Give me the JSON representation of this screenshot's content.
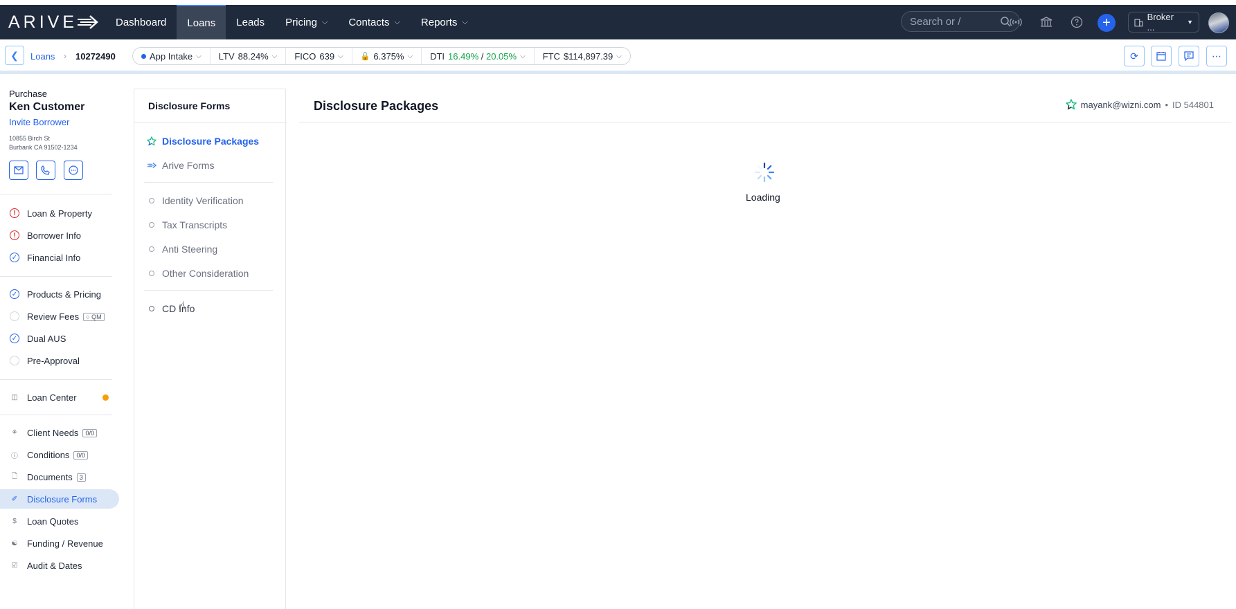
{
  "app": {
    "logo": "ARIVE"
  },
  "navbar": {
    "items": [
      {
        "label": "Dashboard",
        "has_menu": false
      },
      {
        "label": "Loans",
        "has_menu": false,
        "active": true
      },
      {
        "label": "Leads",
        "has_menu": false
      },
      {
        "label": "Pricing",
        "has_menu": true
      },
      {
        "label": "Contacts",
        "has_menu": true
      },
      {
        "label": "Reports",
        "has_menu": true
      }
    ],
    "search_placeholder": "Search or /",
    "broker_label": "Broker ...",
    "colors": {
      "background": "#1f2a3c",
      "accent": "#2563eb"
    }
  },
  "subbar": {
    "breadcrumb": {
      "loans": "Loans",
      "loan_id": "10272490"
    },
    "status": "App Intake",
    "ltv_label": "LTV",
    "ltv_value": "88.24%",
    "fico_label": "FICO",
    "fico_value": "639",
    "rate": "6.375%",
    "dti_label": "DTI",
    "dti_front": "16.49%",
    "dti_sep": " / ",
    "dti_back": "20.05%",
    "ftc_label": "FTC",
    "ftc_value": "$114,897.39"
  },
  "borrower": {
    "loan_type": "Purchase",
    "name": "Ken Customer",
    "invite": "Invite Borrower",
    "address_line1": "10855 Birch St",
    "address_line2": "Burbank CA 91502-1234"
  },
  "sidebar": {
    "group1": [
      {
        "label": "Loan & Property",
        "status": "warning"
      },
      {
        "label": "Borrower Info",
        "status": "warning"
      },
      {
        "label": "Financial Info",
        "status": "complete"
      }
    ],
    "group2": [
      {
        "label": "Products & Pricing",
        "status": "complete"
      },
      {
        "label": "Review Fees",
        "status": "empty",
        "badge": "QM"
      },
      {
        "label": "Dual AUS",
        "status": "complete"
      },
      {
        "label": "Pre-Approval",
        "status": "empty"
      }
    ],
    "loan_center": "Loan Center",
    "group3": [
      {
        "label": "Client Needs",
        "badge": "0/0"
      },
      {
        "label": "Conditions",
        "badge": "0/0"
      },
      {
        "label": "Documents",
        "badge": "3"
      },
      {
        "label": "Disclosure Forms",
        "active": true
      },
      {
        "label": "Loan Quotes"
      },
      {
        "label": "Funding / Revenue"
      },
      {
        "label": "Audit & Dates"
      }
    ]
  },
  "disclosure_nav": {
    "title": "Disclosure Forms",
    "primary": [
      {
        "label": "Disclosure Packages",
        "active": true,
        "icon": "star-icon"
      },
      {
        "label": "Arive Forms",
        "icon": "arrow-icon"
      }
    ],
    "secondary": [
      {
        "label": "Identity Verification"
      },
      {
        "label": "Tax Transcripts"
      },
      {
        "label": "Anti Steering"
      },
      {
        "label": "Other Consideration"
      }
    ],
    "tertiary": [
      {
        "label": "CD Info"
      }
    ]
  },
  "main": {
    "title": "Disclosure Packages",
    "user_email": "mayank@wizni.com",
    "separator": "•",
    "user_id": "ID 544801",
    "loading_text": "Loading"
  }
}
